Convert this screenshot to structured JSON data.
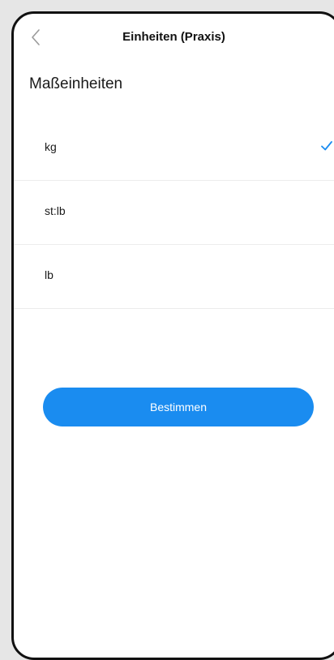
{
  "header": {
    "title": "Einheiten (Praxis)",
    "back_icon": "chevron-left-icon"
  },
  "section": {
    "title": "Maßeinheiten"
  },
  "options": [
    {
      "label": "kg",
      "selected": true
    },
    {
      "label": "st:lb",
      "selected": false
    },
    {
      "label": "lb",
      "selected": false
    }
  ],
  "check_icon": "checkmark-icon",
  "confirm_button": {
    "label": "Bestimmen"
  },
  "colors": {
    "accent": "#1a8cf0",
    "check": "#1a8cf0",
    "background": "#ffffff",
    "frame": "#111111"
  }
}
